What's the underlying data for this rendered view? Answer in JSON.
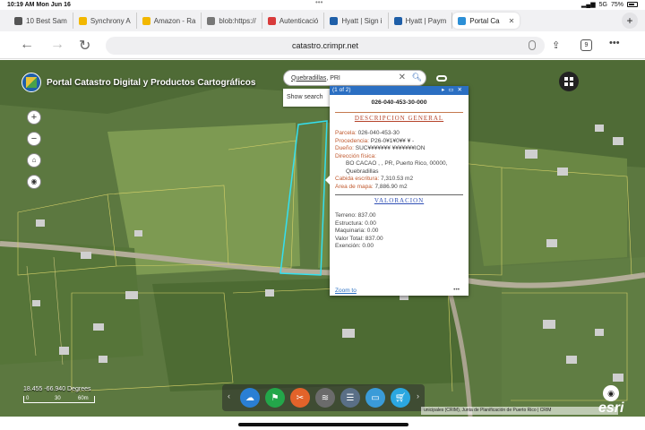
{
  "status": {
    "time": "10:19 AM  Mon Jun 16",
    "signal": "5G",
    "battery": "75%"
  },
  "tabs": [
    {
      "label": "10 Best Sam",
      "color": "#555555"
    },
    {
      "label": "Synchrony A",
      "color": "#f2b700"
    },
    {
      "label": "Amazon - Ra",
      "color": "#f2b700"
    },
    {
      "label": "blob:https://",
      "color": "#777777"
    },
    {
      "label": "Autenticació",
      "color": "#d83b3b"
    },
    {
      "label": "Hyatt | Sign i",
      "color": "#1f5fa8"
    },
    {
      "label": "Hyatt | Paym",
      "color": "#1f5fa8"
    },
    {
      "label": "Portal Ca",
      "color": "#2c8fd6",
      "active": true
    }
  ],
  "newtab": "+",
  "url": "catastro.crimpr.net",
  "tab_count": "9",
  "app": {
    "title": "Portal Catastro Digital y Productos Cartográficos"
  },
  "search": {
    "value": "Quebradillas",
    "suffix": ", PRI",
    "suggest": "Show search"
  },
  "popup": {
    "header": "(1 of 2)",
    "parcel_id": "026-040-453-30-000",
    "section1": "DESCRIPCION GENERAL",
    "fields": [
      {
        "label": "Parcela:",
        "value": " 026-040-453-30"
      },
      {
        "label": "Procedencia:",
        "value": " P26-0¥1¥0¥¥ ¥ -"
      },
      {
        "label": "Dueño:",
        "value": " SUC¥¥¥¥¥¥¥ ¥¥¥¥¥¥¥ION"
      },
      {
        "label": "Dirección física:",
        "value": ""
      }
    ],
    "address": [
      "BO CACAO , , PR, Puerto Rico, 00000,",
      "Quebradillas"
    ],
    "fields2": [
      {
        "label": "Cabida escritura:",
        "value": " 7,310.53 m2"
      },
      {
        "label": "Área de mapa:",
        "value": " 7,886.90 m2"
      }
    ],
    "section2": "VALORACION",
    "values": [
      "Terreno: 837.00",
      "Estructura: 0.00",
      "Maquinaria: 0.00",
      "Valor Total: 837.00",
      "Exención: 0.00"
    ],
    "zoom": "Zoom to",
    "more": "•••"
  },
  "coords": "18.455 -66.940 Degrees",
  "scale": [
    "0",
    "30",
    "60m"
  ],
  "attribution": "unicipales (CRIM), Junta de Planificación de Puerto Rico | CRIM",
  "esri": "esri",
  "dock_colors": [
    "#2a7fd4",
    "#23a64a",
    "#e2632a",
    "#6b6b6b",
    "#5a6f86",
    "#3a9bd8",
    "#2ba7e0"
  ]
}
